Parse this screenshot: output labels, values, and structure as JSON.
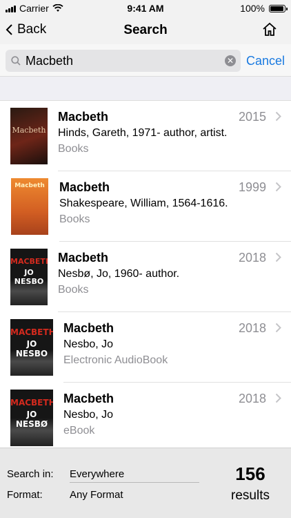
{
  "status_bar": {
    "carrier": "Carrier",
    "time": "9:41 AM",
    "battery": "100%"
  },
  "nav": {
    "back_label": "Back",
    "title": "Search",
    "home_icon": "home-icon",
    "back_icon": "chevron-left-icon"
  },
  "search": {
    "query": "Macbeth",
    "cancel_label": "Cancel",
    "search_icon": "search-icon",
    "clear_icon": "clear-icon"
  },
  "results": [
    {
      "title": "Macbeth",
      "author": "Hinds, Gareth, 1971- author, artist.",
      "format": "Books",
      "year": "2015",
      "cover": {
        "text": "Macbeth",
        "colors": [
          "#1a0f0c",
          "#8e2a1a"
        ]
      }
    },
    {
      "title": "Macbeth",
      "author": "Shakespeare, William, 1564-1616.",
      "format": "Books",
      "year": "1999",
      "cover": {
        "text": "Macbeth",
        "colors": [
          "#e07a28",
          "#a8421c"
        ]
      }
    },
    {
      "title": "Macbeth",
      "author": "Nesbø, Jo, 1960- author.",
      "format": "Books",
      "year": "2018",
      "cover": {
        "text": "MACBETH",
        "subtext": "JO NESBO",
        "colors": [
          "#161616",
          "#3a3a3a"
        ]
      }
    },
    {
      "title": "Macbeth",
      "author": "Nesbo, Jo",
      "format": "Electronic AudioBook",
      "year": "2018",
      "cover": {
        "text": "MACBETH",
        "subtext": "JO NESBO",
        "colors": [
          "#161616",
          "#3a3a3a"
        ]
      }
    },
    {
      "title": "Macbeth",
      "author": "Nesbo, Jo",
      "format": "eBook",
      "year": "2018",
      "cover": {
        "text": "MACBETH",
        "subtext": "JO NESBØ",
        "colors": [
          "#161616",
          "#3a3a3a"
        ]
      }
    }
  ],
  "footer": {
    "search_in_label": "Search in:",
    "search_in_value": "Everywhere",
    "format_label": "Format:",
    "format_value": "Any Format",
    "count": "156",
    "count_label": "results"
  },
  "colors": {
    "accent": "#1a7ae0",
    "secondary_text": "#8e8e93",
    "title_red": "#d42a1e"
  }
}
